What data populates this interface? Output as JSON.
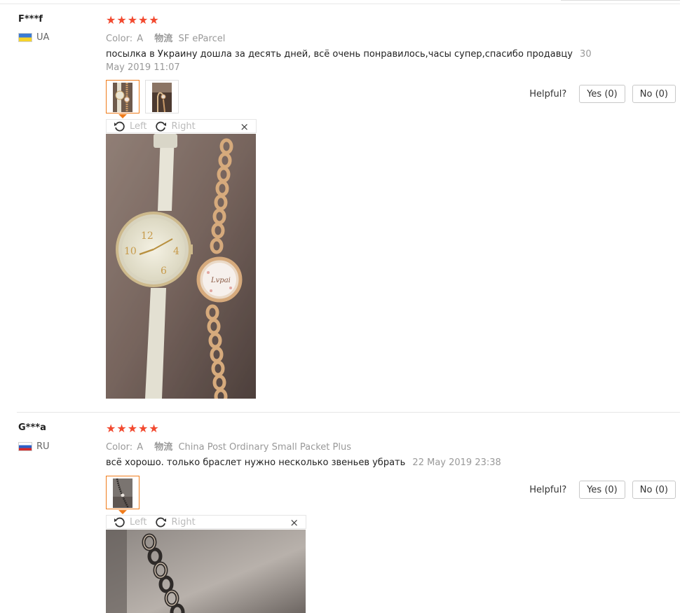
{
  "reviews": [
    {
      "user_name": "F***f",
      "country_code": "UA",
      "rating": 5,
      "color_label": "Color:",
      "color_value": "A",
      "logistics_label": "物流",
      "logistics_value": "SF eParcel",
      "comment": "посылка в Украину дошла за десять дней, всё очень понравилось,часы супер,спасибо продавцу",
      "date": "30 May 2019 11:07",
      "photo_count": 2,
      "viewer": {
        "left": "Left",
        "right": "Right",
        "close": "×"
      },
      "helpful_label": "Helpful?",
      "yes_label": "Yes (0)",
      "no_label": "No (0)"
    },
    {
      "user_name": "G***a",
      "country_code": "RU",
      "rating": 5,
      "color_label": "Color:",
      "color_value": "A",
      "logistics_label": "物流",
      "logistics_value": "China Post Ordinary Small Packet Plus",
      "comment": "всё хорошо. только браслет нужно несколько звеньев убрать",
      "date": "22 May 2019 23:38",
      "photo_count": 1,
      "viewer": {
        "left": "Left",
        "right": "Right",
        "close": "×"
      },
      "helpful_label": "Helpful?",
      "yes_label": "Yes (0)",
      "no_label": "No (0)"
    }
  ],
  "colors": {
    "star": "#f2492f",
    "active_thumb_border": "#f07c1a",
    "muted_text": "#999999"
  }
}
